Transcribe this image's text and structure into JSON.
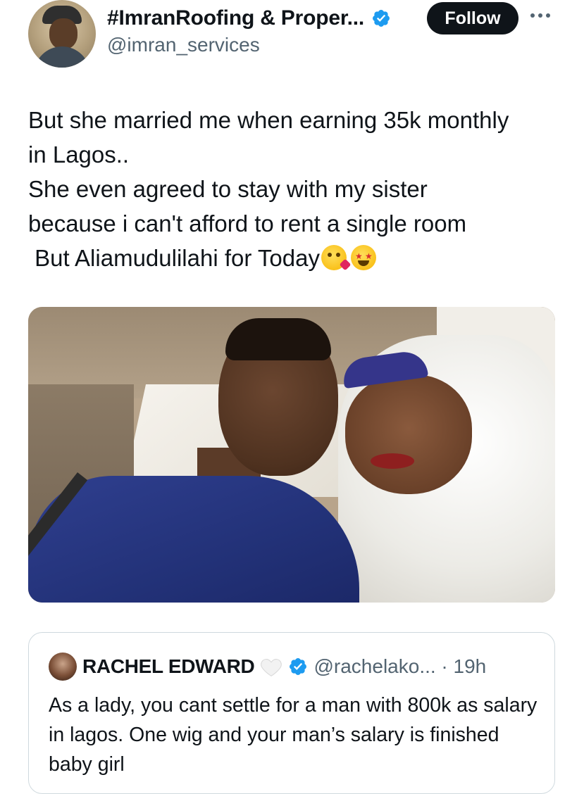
{
  "header": {
    "display_name": "#ImranRoofing & Proper...",
    "handle": "@imran_services",
    "follow_label": "Follow",
    "verified_icon": "verified-badge-icon",
    "more_icon": "more-icon"
  },
  "tweet": {
    "lines": [
      "But she married me when earning 35k monthly",
      "in Lagos..",
      "She even agreed to stay with my sister",
      "because i can't afford to rent a single room",
      " But Aliamudulilahi for Today"
    ],
    "emojis": [
      "face-blowing-kiss-emoji",
      "star-struck-emoji"
    ]
  },
  "media": {
    "kind": "photo",
    "subject": "couple-selfie-in-car"
  },
  "quote": {
    "name": "RACHEL EDWARD",
    "handle_time": "@rachelako... · 19h",
    "text": "As a lady, you cant settle for a man with 800k as salary in lagos. One wig and your man’s salary is finished baby girl"
  },
  "colors": {
    "text": "#0f1419",
    "secondary": "#536471",
    "verified": "#1d9bf0",
    "border": "#cfd9de",
    "follow_bg": "#0f1419"
  }
}
